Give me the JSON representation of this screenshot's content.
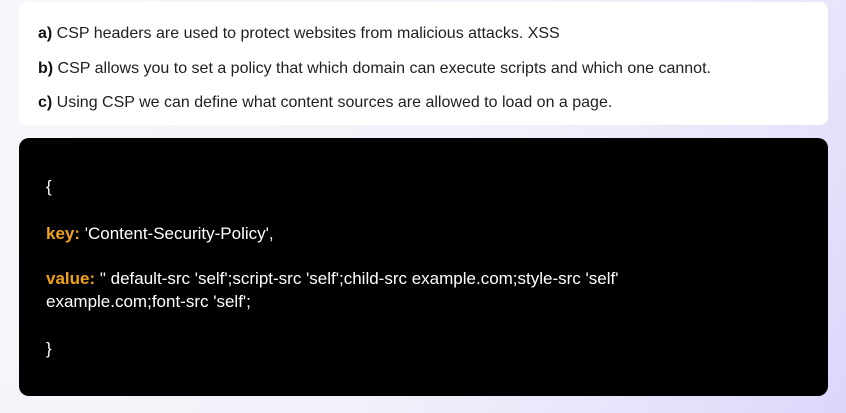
{
  "list": {
    "items": [
      {
        "marker": "a)",
        "text": " CSP headers are used to protect websites from malicious attacks. XSS"
      },
      {
        "marker": "b)",
        "text": " CSP allows you to set a policy that which domain can execute scripts and which one cannot."
      },
      {
        "marker": "c)",
        "text": " Using CSP we can define what content sources are allowed to load on a page."
      }
    ]
  },
  "code": {
    "open_brace": "{",
    "key_label": "key:",
    "key_value": " 'Content-Security-Policy',",
    "value_label": "value:",
    "value_line1": " \" default-src 'self';script-src 'self';child-src example.com;style-src 'self'",
    "value_line2": "example.com;font-src 'self';",
    "close_brace": "}"
  },
  "colors": {
    "keyword": "#f0a21a",
    "code_background": "#000000"
  }
}
